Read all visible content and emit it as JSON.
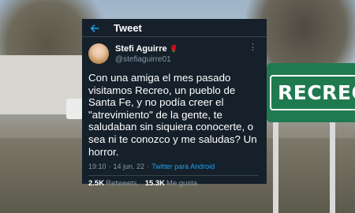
{
  "topbar": {
    "title": "Tweet",
    "back_icon": "arrow-left-icon"
  },
  "author": {
    "display_name": "Stefi Aguirre",
    "emoji": "🌹",
    "handle": "@stefiaguirre01"
  },
  "tweet": {
    "text": "Con una amiga el mes pasado visitamos Recreo, un pueblo de Santa Fe, y no podía creer el \"atrevimiento\" de la gente, te saludaban sin siquiera conocerte, o sea ni te conozco y me saludas? Un horror.",
    "time": "19:10",
    "separator": "·",
    "date": "14 jun. 22",
    "source": "Twitter para Android"
  },
  "stats": {
    "retweets_count": "2.5K",
    "retweets_label": "Retweets",
    "likes_count": "15.3K",
    "likes_label": "Me gusta"
  },
  "background": {
    "sign_text": "RECREO",
    "sign_color": "#1f7a4f"
  },
  "colors": {
    "tweet_bg": "#15202b",
    "accent": "#1da1f2",
    "muted": "#8899a6"
  }
}
